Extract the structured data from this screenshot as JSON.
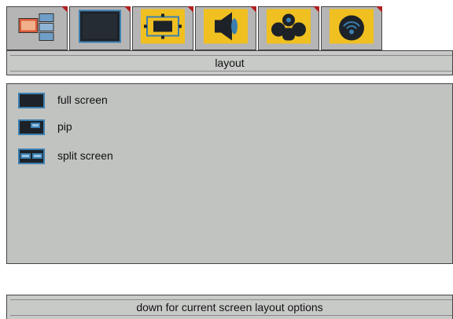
{
  "tabs": [
    {
      "icon": "media-sources-icon"
    },
    {
      "icon": "monitor-screen-icon"
    },
    {
      "icon": "layout-frame-icon"
    },
    {
      "icon": "speaker-icon"
    },
    {
      "icon": "people-group-icon"
    },
    {
      "icon": "broadcast-signal-icon"
    }
  ],
  "title": "layout",
  "options": [
    {
      "label": "full screen",
      "icon": "full-screen-layout-icon"
    },
    {
      "label": "pip",
      "icon": "pip-layout-icon"
    },
    {
      "label": "split screen",
      "icon": "split-screen-layout-icon"
    }
  ],
  "hint": "down for current screen layout options",
  "colors": {
    "tab_bg": "#b5b5b5",
    "tab_highlight": "#f0c020",
    "panel_bg": "#c0c3c0",
    "accent": "#3b7fb0",
    "corner_marker": "#b02020"
  }
}
